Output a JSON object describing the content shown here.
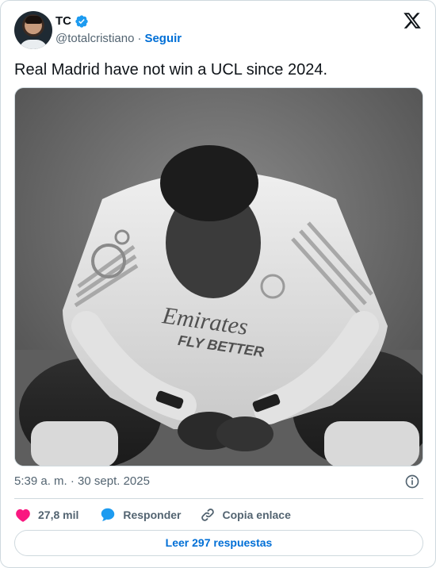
{
  "author": {
    "display_name": "TC",
    "handle": "@totalcristiano",
    "separator": "·",
    "follow_label": "Seguir",
    "verified": true
  },
  "tweet": {
    "text": "Real Madrid have not win a UCL since 2024.",
    "media_alt_icon": "photo-of-player",
    "shirt_sponsor_line1": "Emirates",
    "shirt_sponsor_line2": "FLY BETTER",
    "timestamp": "5:39 a. m. · 30 sept. 2025"
  },
  "actions": {
    "likes_count": "27,8 mil",
    "reply_label": "Responder",
    "copy_link_label": "Copia enlace",
    "read_replies_label": "Leer 297 respuestas"
  },
  "colors": {
    "link_blue": "#006fd6",
    "verified_blue": "#1d9bf0",
    "like_pink": "#f91880",
    "muted": "#536471",
    "border": "#cfd9de"
  }
}
